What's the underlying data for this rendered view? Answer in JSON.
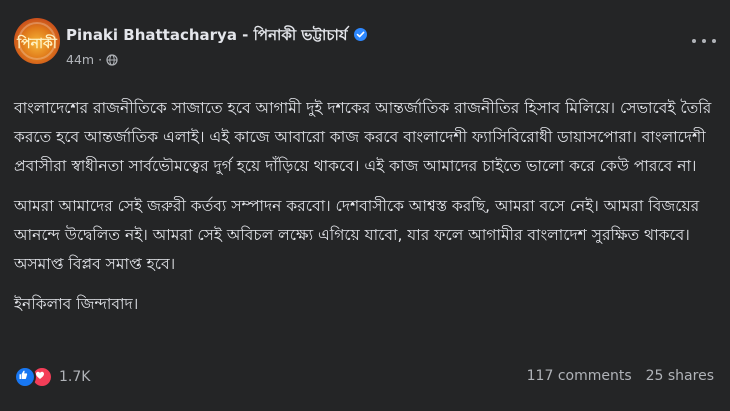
{
  "post": {
    "author_name": "Pinaki Bhattacharya - পিনাকী ভট্টাচার্য",
    "time": "44m",
    "separator": "·",
    "avatar_text": "পিনাকী",
    "paragraphs": [
      "বাংলাদেশের রাজনীতিকে সাজাতে হবে আগামী দুই দশকের আন্তর্জাতিক রাজনীতির হিসাব মিলিয়ে। সেভাবেই তৈরি করতে হবে আন্তর্জাতিক এলাই। এই কাজে আবারো কাজ করবে বাংলাদেশী ফ্যাসিবিরোধী ডায়াসপোরা। বাংলাদেশী প্রবাসীরা স্বাধীনতা সার্বভৌমত্বের দুর্গ হয়ে দাঁড়িয়ে থাকবে। এই কাজ আমাদের চাইতে ভালো করে কেউ পারবে না।",
      "আমরা আমাদের সেই জরুরী কর্তব্য সম্পাদন করবো। দেশবাসীকে আশ্বস্ত করছি, আমরা বসে নেই। আমরা বিজয়ের আনন্দে উদ্বেলিত নই। আমরা সেই অবিচল লক্ষ্যে এগিয়ে যাবো, যার ফলে আগামীর বাংলাদেশ সুরক্ষিত থাকবে। অসমাপ্ত বিপ্লব সমাপ্ত হবে।",
      "ইনকিলাব জিন্দাবাদ।"
    ],
    "reaction_count": "1.7K",
    "comments": "117 comments",
    "shares": "25 shares"
  },
  "icons": {
    "verified": "verified-badge-icon",
    "audience": "globe-icon",
    "more": "more-options-icon",
    "like": "like-reaction-icon",
    "love": "love-reaction-icon"
  },
  "colors": {
    "background": "#242526",
    "text_primary": "#e4e6eb",
    "text_secondary": "#b0b3b8",
    "verified_blue": "#2d88ff",
    "like_blue": "#1877f2",
    "love_red": "#f33e58"
  }
}
